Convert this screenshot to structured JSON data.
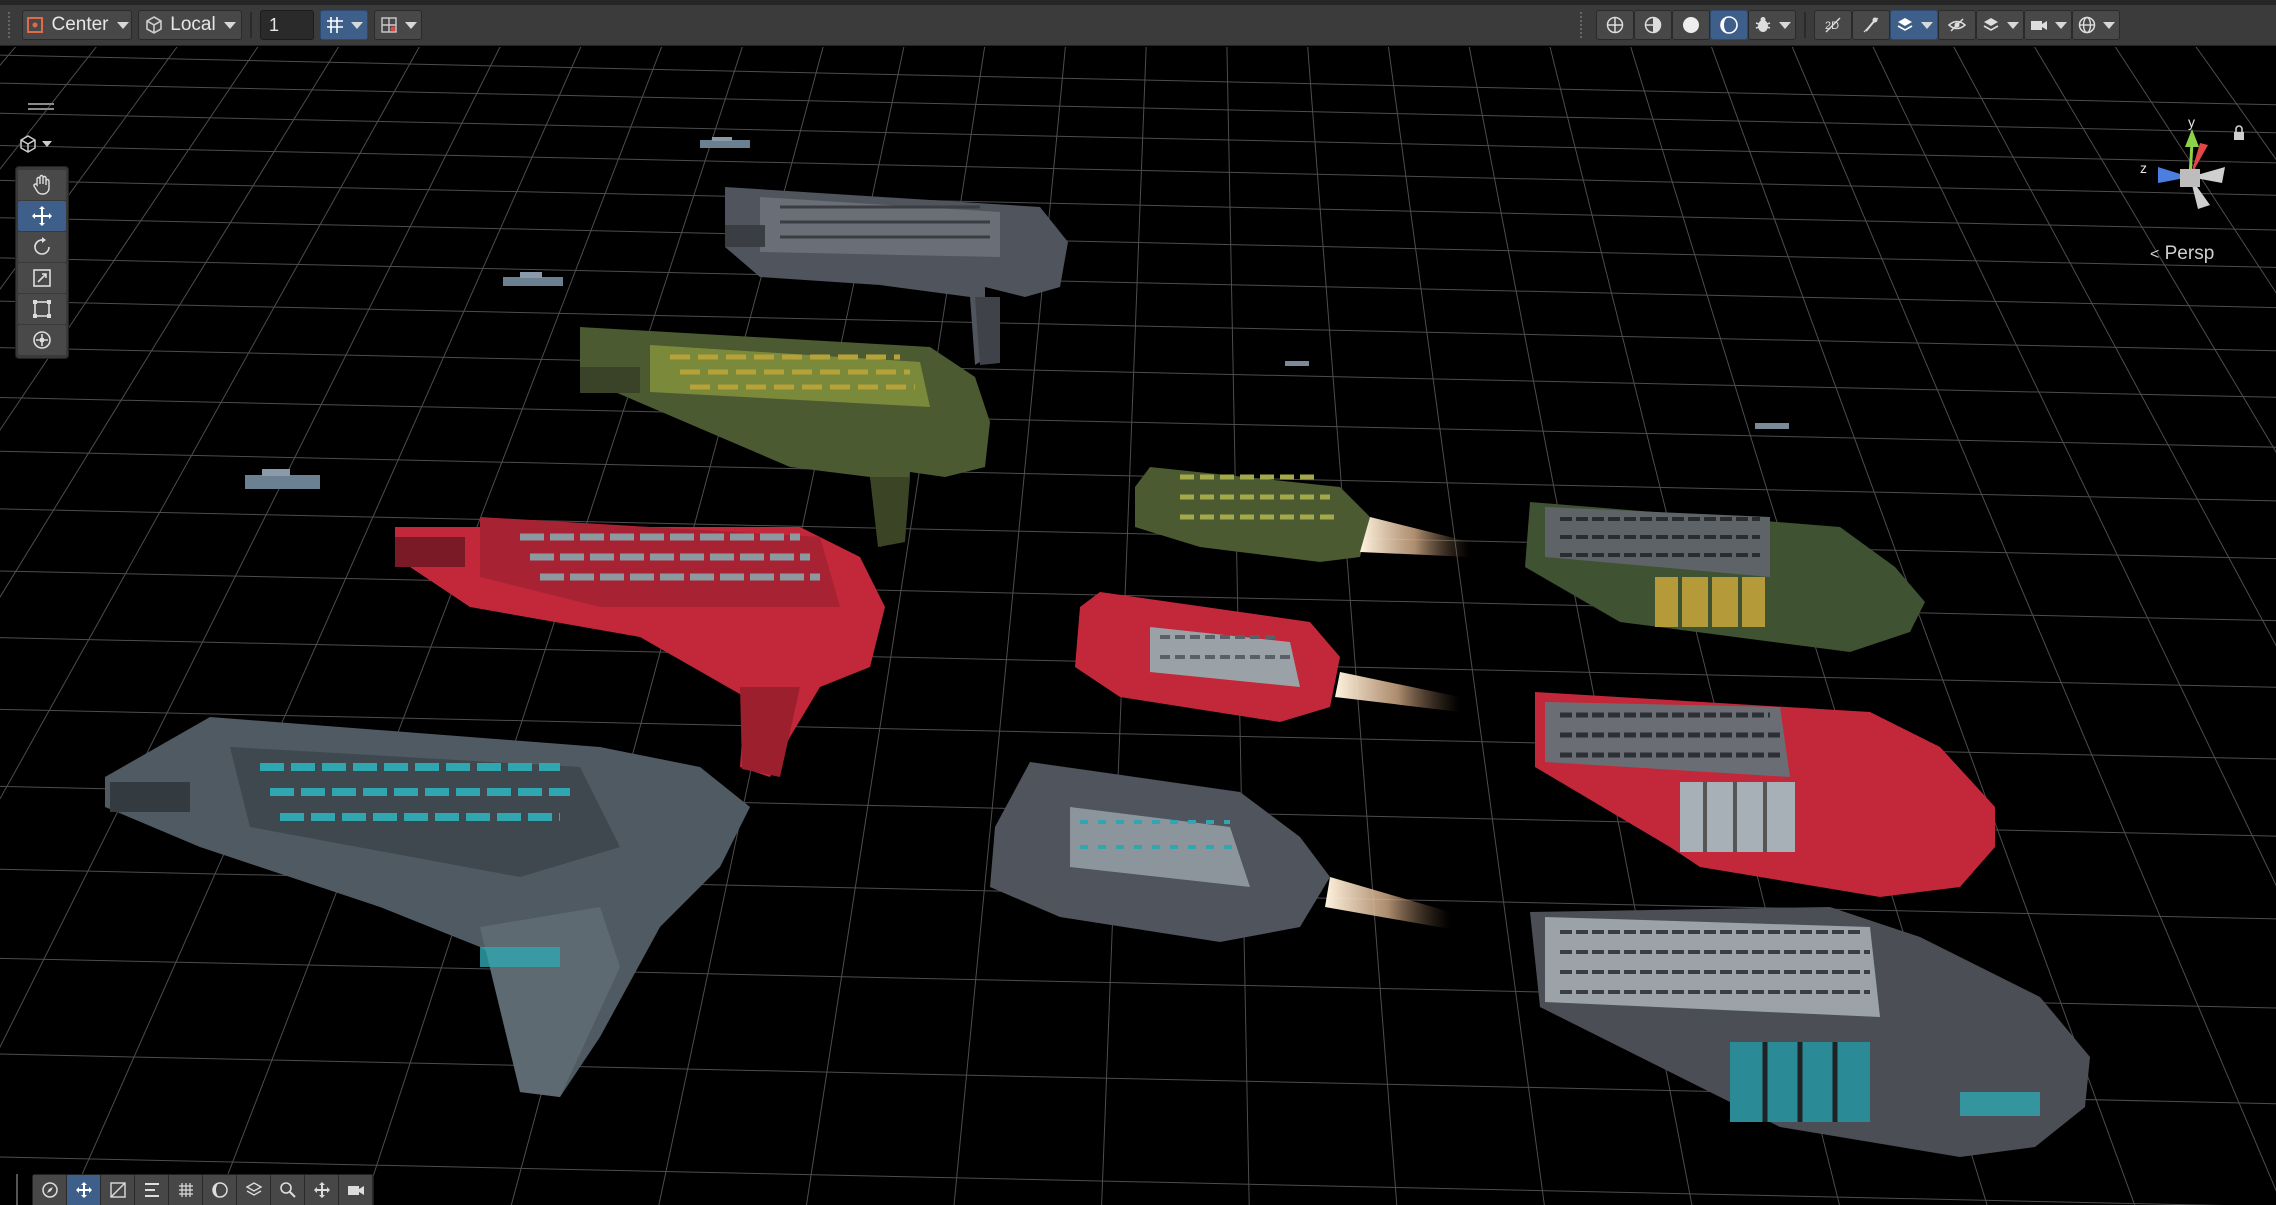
{
  "toolbar": {
    "pivot_mode": "Center",
    "pivot_rotation": "Local",
    "snap_increment": "1"
  },
  "viewport": {
    "projection_label": "Persp",
    "gizmo_axes": {
      "y": "y",
      "z": "z"
    }
  },
  "colors": {
    "toolbar_bg": "#3b3b3b",
    "button_active": "#3e5f8a",
    "grid_line": "#9a9a9a",
    "ship_red": "#c8283a",
    "ship_green": "#4a5a2e",
    "ship_teal": "#2fa6b0",
    "ship_dark": "#4b4f55"
  }
}
